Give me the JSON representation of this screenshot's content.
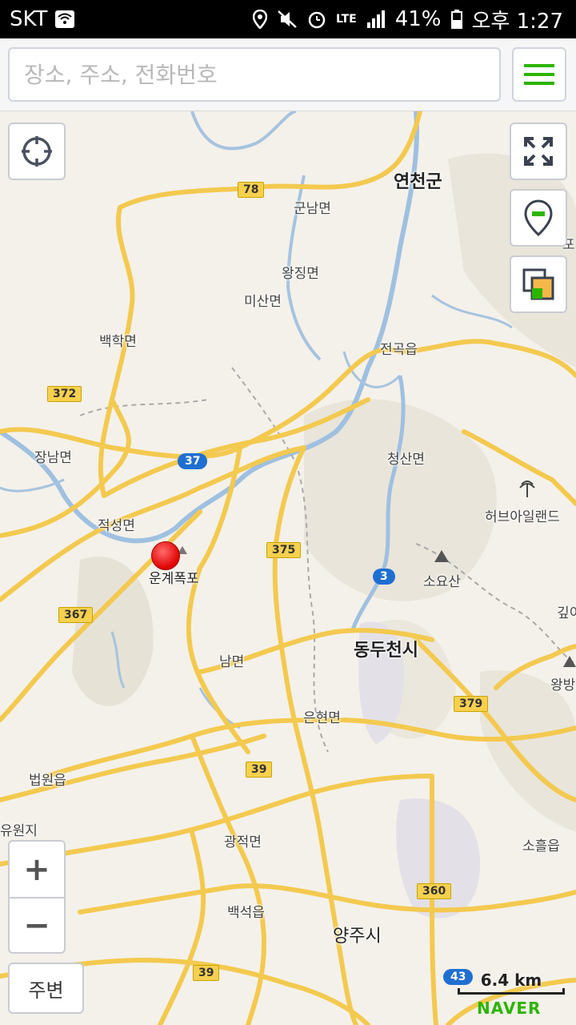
{
  "status_bar": {
    "carrier": "SKT",
    "network": "LTE",
    "battery": "41%",
    "time": "오후 1:27",
    "icons": [
      "wifi-icon",
      "location-icon",
      "mute-icon",
      "alarm-icon",
      "signal-icon",
      "battery-icon"
    ]
  },
  "search": {
    "placeholder": "장소, 주소, 전화번호",
    "value": ""
  },
  "map": {
    "labels": {
      "yeoncheon": "연천군",
      "gunnam": "군남면",
      "wangjing": "왕징면",
      "misan": "미산면",
      "baekhak": "백학면",
      "jeongok": "전곡읍",
      "jangnam": "장남면",
      "cheongsan": "청산면",
      "herbisland": "허브아일랜드",
      "jeokseong": "적성면",
      "ungyefalls": "운계폭포",
      "soyosan": "소요산",
      "dongducheon": "동두천시",
      "nam": "남면",
      "eunhyeon": "은현면",
      "beobwon": "법원읍",
      "yuwonji": "유원지",
      "gwangjeok": "광적면",
      "baekseok": "백석읍",
      "yangju": "양주시",
      "soheul": "소흘읍",
      "wangbang": "왕방",
      "gip": "깊이",
      "edge_po": "포"
    },
    "routes": {
      "r78": "78",
      "r372": "372",
      "r37": "37",
      "r375": "375",
      "r3": "3",
      "r367": "367",
      "r379": "379",
      "r39a": "39",
      "r360": "360",
      "r39b": "39",
      "r43": "43"
    },
    "marker": "red-location-marker",
    "scale": "6.4 km",
    "brand": "NAVER"
  },
  "controls": {
    "zoom_in": "+",
    "zoom_out": "−",
    "nearby_label": "주변"
  },
  "colors": {
    "road": "#f3c94f",
    "water": "#9fc0e0",
    "land": "#f4f1ea",
    "accent_green": "#2db400",
    "marker_red": "#e00000"
  }
}
